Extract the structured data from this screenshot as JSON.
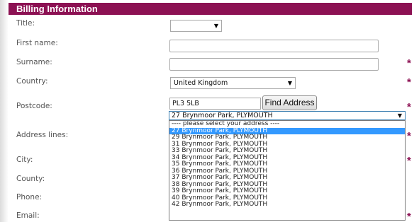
{
  "header": {
    "title": "Billing Information"
  },
  "labels": {
    "title": "Title:",
    "first_name": "First name:",
    "surname": "Surname:",
    "country": "Country:",
    "postcode": "Postcode:",
    "address_lines": "Address lines:",
    "city": "City:",
    "county": "County:",
    "phone": "Phone:",
    "email": "Email:"
  },
  "required_marker": "*",
  "fields": {
    "title_value": "",
    "first_name_value": "",
    "surname_value": "",
    "country_value": "United Kingdom",
    "postcode_value": "PL3 5LB"
  },
  "buttons": {
    "find_address": "Find Address"
  },
  "address_select": {
    "selected": "27 Brynmoor Park, PLYMOUTH",
    "options": [
      "---- please select your address ----",
      "27 Brynmoor Park, PLYMOUTH",
      "29 Brynmoor Park, PLYMOUTH",
      "31 Brynmoor Park, PLYMOUTH",
      "33 Brynmoor Park, PLYMOUTH",
      "34 Brynmoor Park, PLYMOUTH",
      "35 Brynmoor Park, PLYMOUTH",
      "36 Brynmoor Park, PLYMOUTH",
      "37 Brynmoor Park, PLYMOUTH",
      "38 Brynmoor Park, PLYMOUTH",
      "39 Brynmoor Park, PLYMOUTH",
      "40 Brynmoor Park, PLYMOUTH",
      "42 Brynmoor Park, PLYMOUTH"
    ],
    "highlighted_index": 1
  },
  "colors": {
    "header_bg": "#8c1153",
    "required_star": "#8c1153",
    "selection": "#3399ff"
  },
  "icons": {
    "dropdown_arrow": "chevron-down-icon"
  }
}
